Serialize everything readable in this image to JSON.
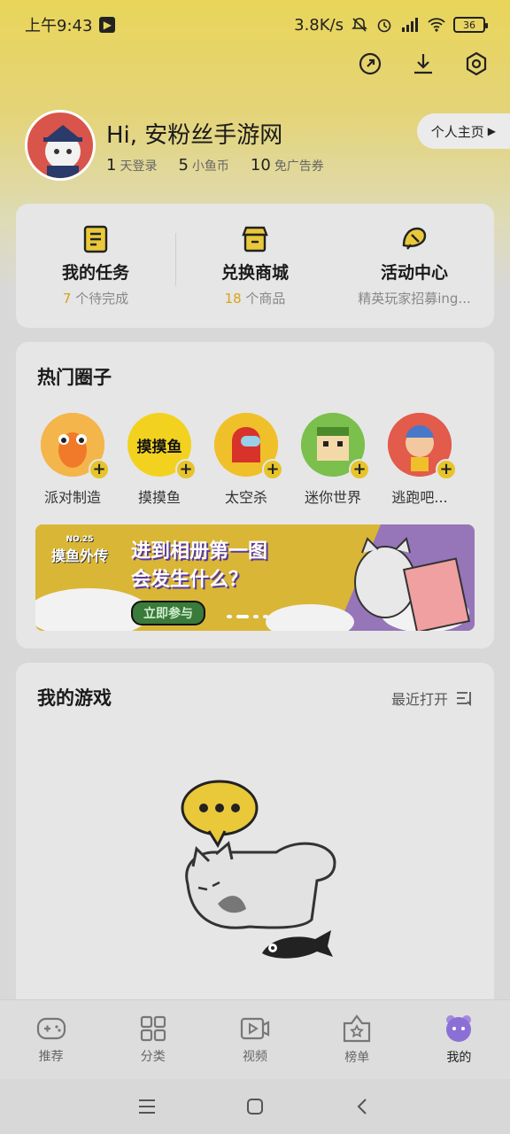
{
  "status_bar": {
    "time": "上午9:43",
    "network_speed": "3.8K/s",
    "battery": "36"
  },
  "top_actions": {
    "icons": [
      "share-icon",
      "download-icon",
      "settings-icon"
    ]
  },
  "profile": {
    "greeting": "Hi, 安粉丝手游网",
    "stats": [
      {
        "value": "1",
        "label": "天登录"
      },
      {
        "value": "5",
        "label": "小鱼币"
      },
      {
        "value": "10",
        "label": "免广告券"
      }
    ],
    "home_button": "个人主页"
  },
  "quick_links": [
    {
      "title": "我的任务",
      "count": "7",
      "suffix": " 个待完成",
      "icon": "task-icon"
    },
    {
      "title": "兑换商城",
      "count": "18",
      "suffix": " 个商品",
      "icon": "shop-icon"
    },
    {
      "title": "活动中心",
      "sub": "精英玩家招募ing...",
      "icon": "activity-icon"
    }
  ],
  "hot_circles": {
    "title": "热门圈子",
    "items": [
      {
        "label": "派对制造",
        "color": "#f0a03a"
      },
      {
        "label": "摸摸鱼",
        "color": "#f2d21f",
        "mark": "摸摸鱼"
      },
      {
        "label": "太空杀",
        "color": "#f0c02a"
      },
      {
        "label": "迷你世界",
        "color": "#7bbf4d"
      },
      {
        "label": "逃跑吧...",
        "color": "#e25b4b"
      }
    ],
    "banner": {
      "badge": "NO.25",
      "series": "摸鱼外传",
      "line1": "进到相册第一图",
      "line2": "会发生什么？",
      "cta": "立即参与"
    }
  },
  "my_games": {
    "title": "我的游戏",
    "sort_label": "最近打开"
  },
  "tabbar": [
    {
      "label": "推荐",
      "icon": "gamepad-icon",
      "active": false
    },
    {
      "label": "分类",
      "icon": "grid-icon",
      "active": false
    },
    {
      "label": "视频",
      "icon": "video-icon",
      "active": false
    },
    {
      "label": "榜单",
      "icon": "ranking-icon",
      "active": false
    },
    {
      "label": "我的",
      "icon": "profile-icon",
      "active": true
    }
  ],
  "colors": {
    "brand_yellow": "#e9d55a",
    "highlight": "#d9a21b",
    "active_tab": "#8c6fd6"
  }
}
